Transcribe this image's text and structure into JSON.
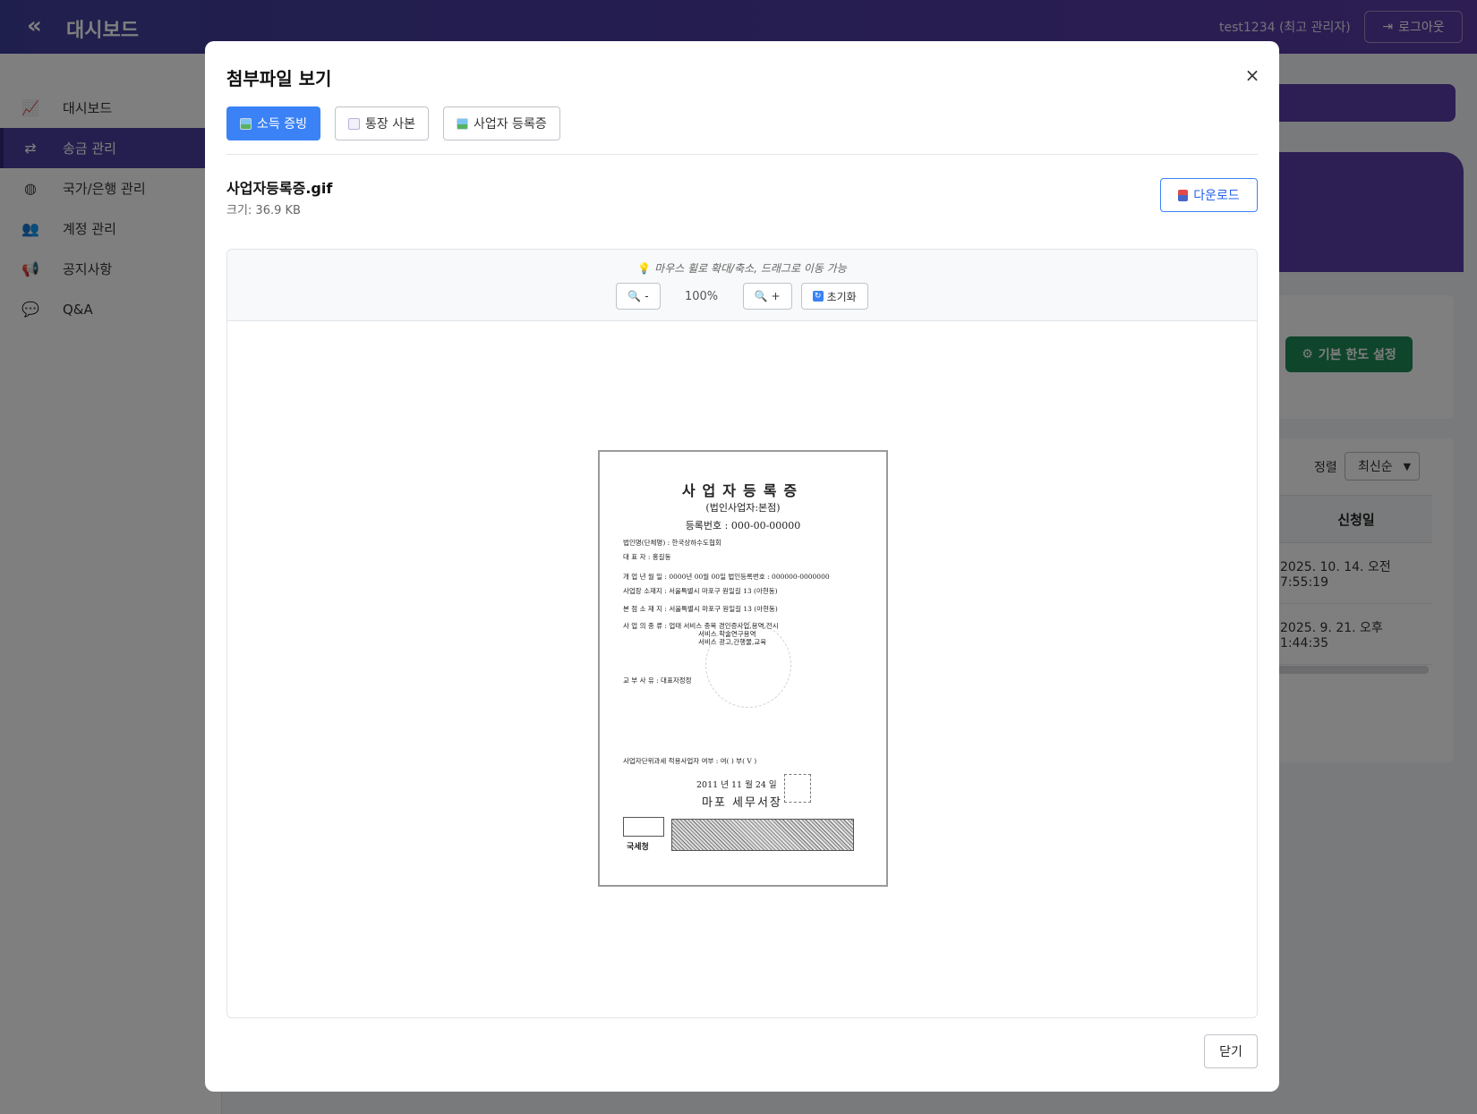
{
  "header": {
    "collapse_icon": "«",
    "title": "대시보드",
    "user": "test1234 (최고 관리자)",
    "logout_label": "로그아웃"
  },
  "sidebar": {
    "items": [
      {
        "label": "대시보드",
        "icon": "chart-line-icon"
      },
      {
        "label": "송금 관리",
        "icon": "exchange-icon",
        "active": true
      },
      {
        "label": "국가/은행 관리",
        "icon": "globe-icon"
      },
      {
        "label": "계정 관리",
        "icon": "users-icon"
      },
      {
        "label": "공지사항",
        "icon": "megaphone-icon"
      },
      {
        "label": "Q&A",
        "icon": "comments-icon"
      }
    ]
  },
  "background": {
    "default_limit_button": "기본 한도 설정",
    "sort_label": "정렬",
    "sort_value": "최신순",
    "column_header": "신청일",
    "rows": [
      "2025. 10. 14. 오전 7:55:19",
      "2025. 9. 21. 오후 1:44:35"
    ]
  },
  "modal": {
    "title": "첨부파일 보기",
    "close_icon": "×",
    "tabs": [
      {
        "label": "소득 증빙",
        "icon": "image-icon",
        "active": true
      },
      {
        "label": "통장 사본",
        "icon": "document-icon"
      },
      {
        "label": "사업자 등록증",
        "icon": "image-icon"
      }
    ],
    "file_name": "사업자등록증.gif",
    "file_size": "크기: 36.9 KB",
    "download_label": "다운로드",
    "viewer": {
      "hint": "마우스 휠로 확대/축소, 드래그로 이동 가능",
      "zoom_out_label": "-",
      "zoom_level": "100%",
      "zoom_in_label": "+",
      "reset_label": "초기화"
    },
    "document": {
      "title": "사업자등록증",
      "subtitle": "(법인사업자:본점)",
      "reg_no": "등록번호 : 000-00-00000",
      "lines": [
        "법인명(단체명) : 한국상하수도협회",
        "대  표  자 : 홍길동",
        "개 업 년 월 일 : 0000년 00월 00일     법인등록번호 : 000000-0000000",
        "사업장 소재지 : 서울특별시 마포구 원일길 13 (아현동)",
        "본 점 소 재 지 : 서울특별시 마포구 원일길 13 (아현동)",
        "사 업 의 종 류 : 업태 서비스          종목 경인증사업,용역,전시",
        "서비스                      학술연구용역",
        "서비스                      광고,간행물,교육",
        "교 부 사 유 : 대표자정정",
        "사업자단위과세 적용사업자 여부 : 여(   )  부( V )"
      ],
      "date": "2011 년   11 월   24 일",
      "office": "마포 세무서장",
      "issuer": "국세청"
    },
    "close_label": "닫기"
  }
}
